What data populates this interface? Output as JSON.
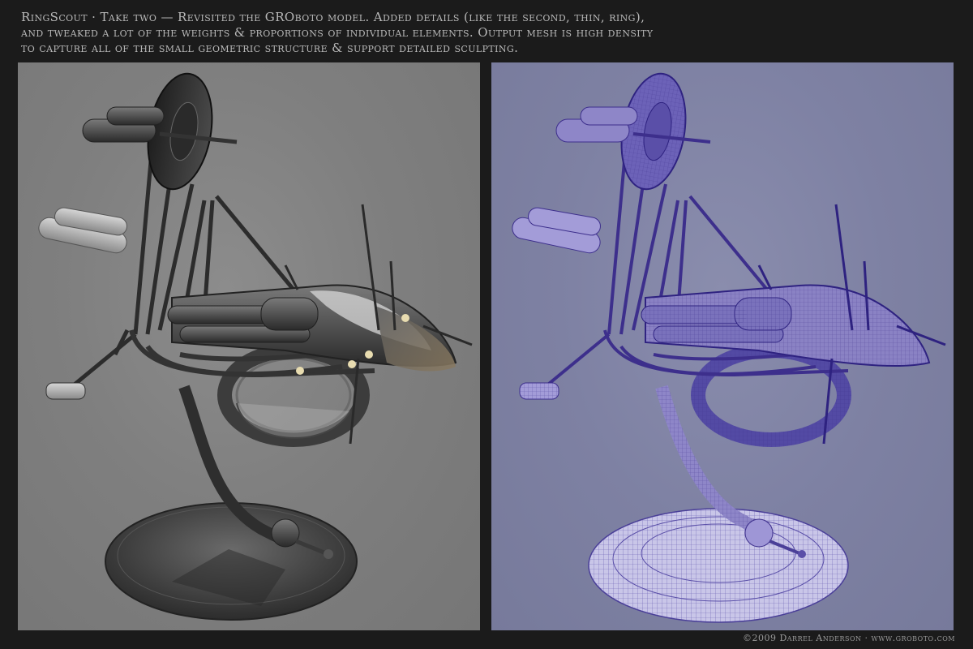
{
  "caption": {
    "line1": "RingScout · Take two — Revisited the GROboto model. Added details (like the second, thin, ring),",
    "line2": "and tweaked a lot of the weights & proportions of individual elements. Output mesh is high density",
    "line3": "to capture all of the small geometric structure & support detailed sculpting."
  },
  "credit": "©2009 Darrel Anderson · www.groboto.com",
  "render_panel": {
    "background": "#7f7f7f",
    "model_color": "#3a3a3a"
  },
  "wireframe_panel": {
    "background": "#7e81a3",
    "model_color": "#6a5fb4"
  },
  "icons": [
    "groboto-logo-icon"
  ]
}
